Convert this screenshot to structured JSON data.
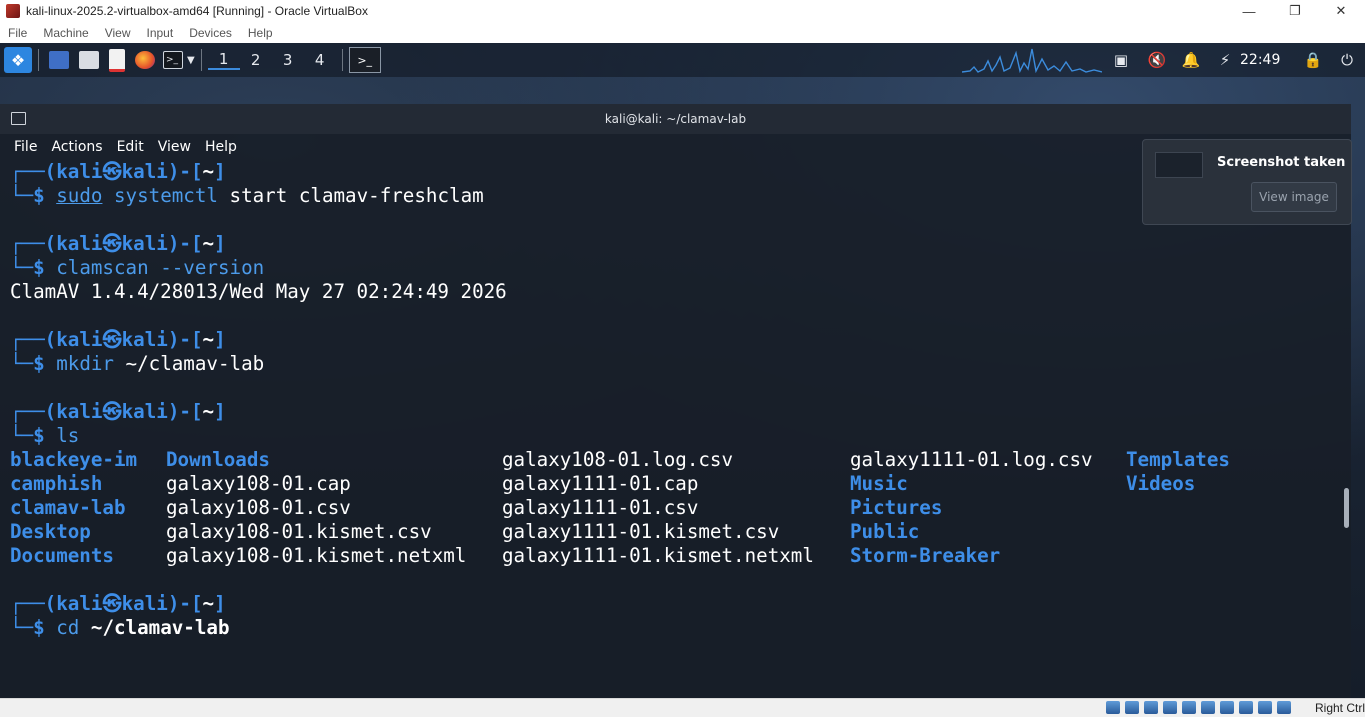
{
  "vbox": {
    "title": "kali-linux-2025.2-virtualbox-amd64 [Running] - Oracle VirtualBox",
    "menu": [
      "File",
      "Machine",
      "View",
      "Input",
      "Devices",
      "Help"
    ],
    "host_key": "Right Ctrl"
  },
  "panel": {
    "workspaces": [
      "1",
      "2",
      "3",
      "4"
    ],
    "active_workspace": 0,
    "clock": "22:49",
    "icons": [
      "kali-menu-icon",
      "show-desktop-icon",
      "file-manager-icon",
      "text-editor-icon",
      "firefox-icon",
      "terminal-icon",
      "chevron-down-icon",
      "terminal-task-icon",
      "display-icon",
      "mute-icon",
      "bell-icon",
      "power-icon",
      "lock-icon",
      "logout-icon"
    ]
  },
  "terminal": {
    "title": "kali@kali: ~/clamav-lab",
    "menu": [
      "File",
      "Actions",
      "Edit",
      "View",
      "Help"
    ],
    "prompt": {
      "top_open": "┌──(",
      "user": "kali",
      "at": "㉿",
      "host": "kali",
      "mid": ")-[",
      "cwd": "~",
      "top_close": "]",
      "bottom": "└─$"
    },
    "blocks": [
      {
        "cmd": "sudo",
        "cmd_underline": true,
        "rest_colored": "systemctl",
        "rest_plain": "start clamav-freshclam",
        "output": []
      },
      {
        "cmd": "clamscan",
        "cmd_underline": false,
        "rest_colored": "--version",
        "rest_plain": "",
        "output": [
          "ClamAV 1.4.4/28013/Wed May 27 02:24:49 2026"
        ]
      },
      {
        "cmd": "mkdir",
        "cmd_underline": false,
        "rest_colored": "",
        "rest_plain": "~/clamav-lab",
        "output": []
      },
      {
        "cmd": "ls",
        "cmd_underline": false,
        "rest_colored": "",
        "rest_plain": "",
        "output": []
      }
    ],
    "ls_columns": [
      [
        {
          "name": "blackeye-im",
          "dir": true
        },
        {
          "name": "camphish",
          "dir": true
        },
        {
          "name": "clamav-lab",
          "dir": true
        },
        {
          "name": "Desktop",
          "dir": true
        },
        {
          "name": "Documents",
          "dir": true
        }
      ],
      [
        {
          "name": "Downloads",
          "dir": true
        },
        {
          "name": "galaxy108-01.cap",
          "dir": false
        },
        {
          "name": "galaxy108-01.csv",
          "dir": false
        },
        {
          "name": "galaxy108-01.kismet.csv",
          "dir": false
        },
        {
          "name": "galaxy108-01.kismet.netxml",
          "dir": false
        }
      ],
      [
        {
          "name": "galaxy108-01.log.csv",
          "dir": false
        },
        {
          "name": "galaxy1111-01.cap",
          "dir": false
        },
        {
          "name": "galaxy1111-01.csv",
          "dir": false
        },
        {
          "name": "galaxy1111-01.kismet.csv",
          "dir": false
        },
        {
          "name": "galaxy1111-01.kismet.netxml",
          "dir": false
        }
      ],
      [
        {
          "name": "galaxy1111-01.log.csv",
          "dir": false
        },
        {
          "name": "Music",
          "dir": true
        },
        {
          "name": "Pictures",
          "dir": true
        },
        {
          "name": "Public",
          "dir": true
        },
        {
          "name": "Storm-Breaker",
          "dir": true
        }
      ],
      [
        {
          "name": "Templates",
          "dir": true
        },
        {
          "name": "Videos",
          "dir": true
        }
      ]
    ],
    "last_cmd": {
      "cmd": "cd",
      "arg": "~/clamav-lab"
    }
  },
  "notification": {
    "title": "Screenshot taken",
    "button": "View image"
  },
  "colors": {
    "prompt_blue": "#3e8ee8",
    "dir_blue": "#3e8ee8",
    "text": "#ffffff"
  }
}
